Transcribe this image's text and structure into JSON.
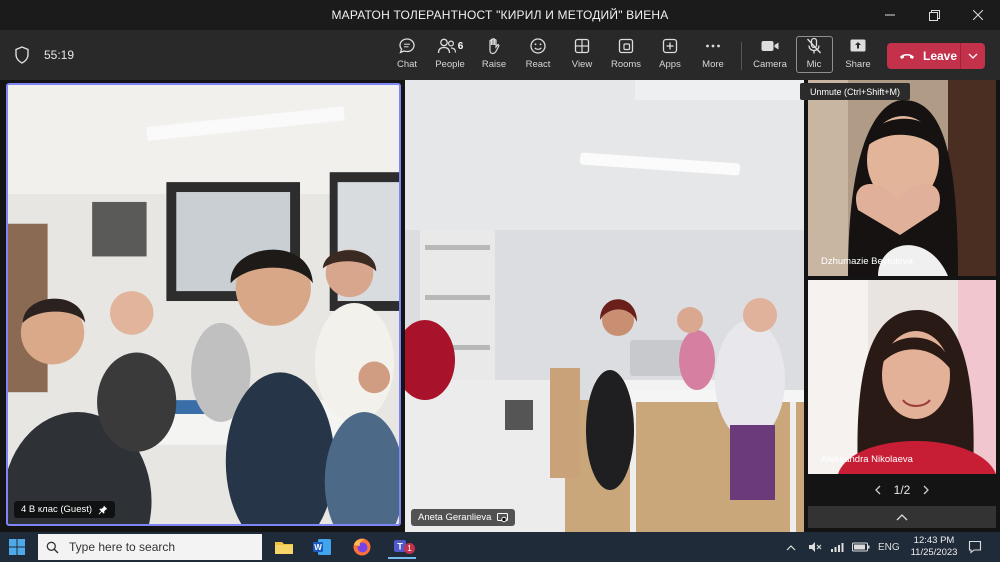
{
  "window": {
    "title": "МАРАТОН ТОЛЕРАНТНОСТ \"КИРИЛ И МЕТОДИЙ\" ВИЕНА",
    "minimize_icon": "minimize-icon",
    "maximize_icon": "restore-icon",
    "close_icon": "close-icon"
  },
  "toolbar": {
    "meeting_timer": "55:19",
    "buttons": {
      "chat": "Chat",
      "people": "People",
      "people_count": "6",
      "raise": "Raise",
      "react": "React",
      "view": "View",
      "rooms": "Rooms",
      "apps": "Apps",
      "more": "More",
      "camera": "Camera",
      "mic": "Mic",
      "share": "Share"
    },
    "leave_label": "Leave",
    "mic_tooltip": "Unmute (Ctrl+Shift+M)"
  },
  "participants": [
    {
      "name": "4 В клас (Guest)",
      "pinned": true
    },
    {
      "name": "Aneta Geranlieva",
      "pinned": false
    },
    {
      "name": "Dzhumazie Beytulova",
      "pinned": false
    },
    {
      "name": "Aleksandra Nikolaeva",
      "pinned": false
    }
  ],
  "pager": {
    "label": "1/2"
  },
  "taskbar": {
    "search_placeholder": "Type here to search",
    "teams_badge": "1",
    "language": "ENG",
    "time": "12:43 PM",
    "date": "11/25/2023"
  },
  "colors": {
    "active_speaker_border": "#7f85f5",
    "leave_button": "#c4314b",
    "taskbar": "#202b3a",
    "toolbar": "#292929"
  }
}
